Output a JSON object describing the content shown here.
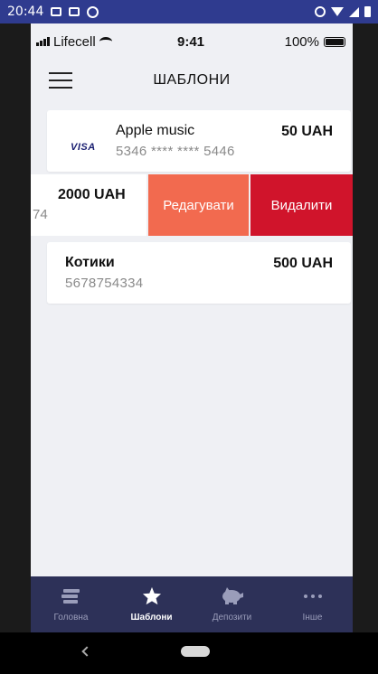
{
  "android_status": {
    "time": "20:44"
  },
  "ios_status": {
    "carrier": "Lifecell",
    "time": "9:41",
    "battery": "100%"
  },
  "header": {
    "title": "ШАБЛОНИ"
  },
  "templates": [
    {
      "name": "Apple music",
      "number": "5346 **** **** 5446",
      "amount": "50 UAH",
      "brand": "VISA"
    },
    {
      "amount": "2000 UAH",
      "number_fragment": "74",
      "actions": {
        "edit": "Редагувати",
        "delete": "Видалити"
      }
    },
    {
      "name": "Котики",
      "number": "5678754334",
      "amount": "500 UAH"
    }
  ],
  "tabs": [
    {
      "label": "Головна",
      "icon": "cards-icon"
    },
    {
      "label": "Шаблони",
      "icon": "star-icon",
      "active": true
    },
    {
      "label": "Депозити",
      "icon": "piggy-bank-icon"
    },
    {
      "label": "Інше",
      "icon": "more-icon"
    }
  ],
  "colors": {
    "tabbar": "#2d3158",
    "edit": "#f26a4f",
    "delete": "#d0142b",
    "visa": "#1a1f71"
  }
}
